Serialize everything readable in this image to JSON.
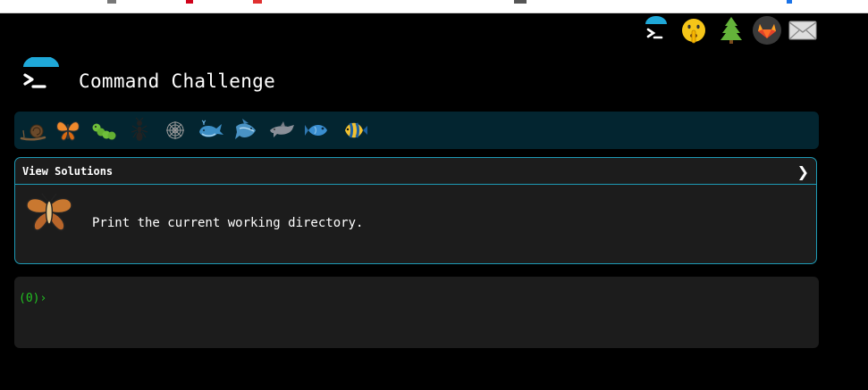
{
  "header": {
    "title": "Command Challenge",
    "logo_icon": "terminal-umbrella-icon"
  },
  "top_icons": [
    {
      "name": "terminal-icon"
    },
    {
      "name": "shushing-face-icon"
    },
    {
      "name": "tree-icon"
    },
    {
      "name": "gitlab-icon"
    },
    {
      "name": "envelope-icon"
    }
  ],
  "creatures": [
    {
      "name": "snail-icon"
    },
    {
      "name": "butterfly-icon"
    },
    {
      "name": "caterpillar-icon"
    },
    {
      "name": "ant-icon"
    },
    {
      "name": "spider-web-icon"
    },
    {
      "name": "whale-icon"
    },
    {
      "name": "shark-icon"
    },
    {
      "name": "dolphin-icon"
    },
    {
      "name": "fish-icon"
    },
    {
      "name": "tropical-fish-icon"
    }
  ],
  "challenge": {
    "view_solutions_label": "View Solutions",
    "chevron": "❯",
    "description": "Print the current working directory.",
    "icon": "moth-icon"
  },
  "terminal": {
    "prompt_prefix": "(0)",
    "prompt_symbol": "›",
    "input_value": ""
  },
  "colors": {
    "background": "#000000",
    "accent": "#1e9ab5",
    "panel": "#1c1c1c",
    "creature_bar": "#032530",
    "prompt": "#22c222"
  }
}
